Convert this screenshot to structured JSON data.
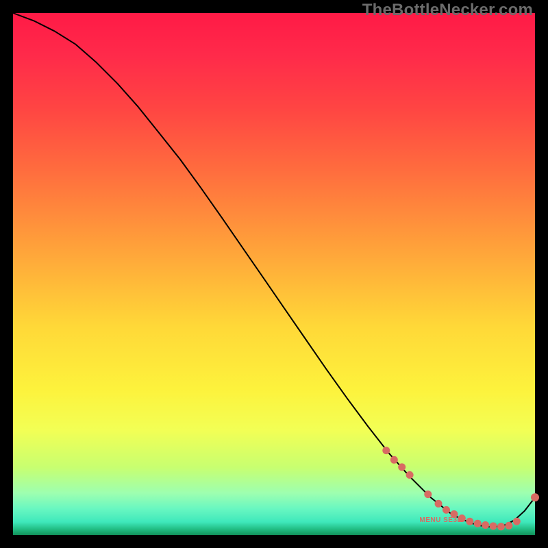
{
  "watermark": "TheBottleNecker.com",
  "chart_data": {
    "type": "line",
    "title": "",
    "xlabel": "",
    "ylabel": "",
    "xlim": [
      0,
      100
    ],
    "ylim": [
      0,
      100
    ],
    "annotation": "MENU SE3B",
    "annotation_xy": [
      82,
      2.5
    ],
    "series": [
      {
        "name": "curve",
        "x": [
          0,
          4,
          8,
          12,
          16,
          20,
          24,
          28,
          32,
          36,
          40,
          44,
          48,
          52,
          56,
          60,
          64,
          68,
          72,
          76,
          80,
          84,
          86,
          88,
          90,
          92,
          94,
          96,
          98,
          100
        ],
        "y": [
          100,
          98.5,
          96.5,
          94,
          90.5,
          86.5,
          82,
          77,
          72,
          66.5,
          60.8,
          55,
          49.2,
          43.4,
          37.6,
          31.8,
          26.2,
          20.8,
          15.7,
          11.2,
          7.2,
          4.0,
          3.0,
          2.2,
          1.7,
          1.5,
          1.8,
          2.8,
          4.6,
          7.2
        ]
      }
    ],
    "markers": {
      "name": "dots",
      "x": [
        71.5,
        73.0,
        74.5,
        76.0,
        79.5,
        81.5,
        83.0,
        84.5,
        86.0,
        87.5,
        89.0,
        90.5,
        92.0,
        93.5,
        95.0,
        96.5,
        100.0
      ],
      "y": [
        16.2,
        14.4,
        13.0,
        11.5,
        7.8,
        6.0,
        4.8,
        4.0,
        3.2,
        2.6,
        2.2,
        1.9,
        1.7,
        1.6,
        1.8,
        2.6,
        7.2
      ]
    },
    "background": "rainbow-vertical"
  }
}
